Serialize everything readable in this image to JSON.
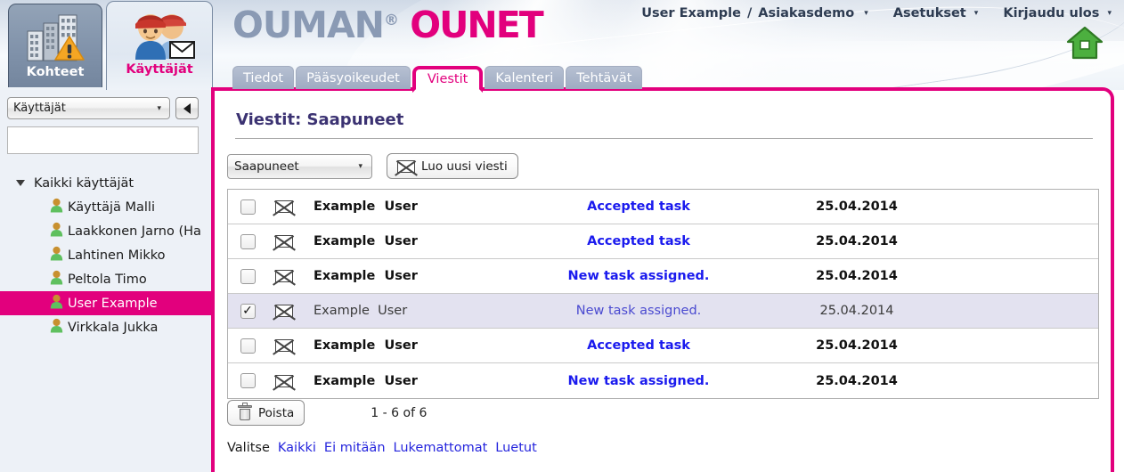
{
  "header": {
    "logo_primary": "OUMAN",
    "logo_reg": "®",
    "logo_secondary": "OUNET",
    "nav": {
      "user": "User Example",
      "separator": "/",
      "customer": "Asiakasdemo",
      "settings": "Asetukset",
      "logout": "Kirjaudu ulos",
      "caret": "▾"
    },
    "home_icon": "home-icon"
  },
  "app_tabs": [
    {
      "label": "Kohteet",
      "icon": "buildings-warning-icon",
      "active": false
    },
    {
      "label": "Käyttäjät",
      "icon": "users-mail-icon",
      "active": true
    }
  ],
  "sidebar": {
    "selector_value": "Käyttäjät",
    "collapse_icon": "chevron-left-icon",
    "search_value": "",
    "search_placeholder": "",
    "tree_root": "Kaikki käyttäjät",
    "items": [
      {
        "label": "Käyttäjä Malli",
        "selected": false
      },
      {
        "label": "Laakkonen Jarno (Ha",
        "selected": false
      },
      {
        "label": "Lahtinen Mikko",
        "selected": false
      },
      {
        "label": "Peltola Timo",
        "selected": false
      },
      {
        "label": "User Example",
        "selected": true
      },
      {
        "label": "Virkkala Jukka",
        "selected": false
      }
    ]
  },
  "content_tabs": [
    {
      "label": "Tiedot",
      "active": false
    },
    {
      "label": "Pääsyoikeudet",
      "active": false
    },
    {
      "label": "Viestit",
      "active": true
    },
    {
      "label": "Kalenteri",
      "active": false
    },
    {
      "label": "Tehtävät",
      "active": false
    }
  ],
  "main": {
    "page_title": "Viestit: Saapuneet",
    "folder_select": "Saapuneet",
    "new_message_label": "Luo uusi viesti",
    "new_message_icon": "envelope-icon",
    "rows": [
      {
        "checked": false,
        "read": false,
        "from_first": "Example",
        "from_last": "User",
        "subject": "Accepted task",
        "date": "25.04.2014"
      },
      {
        "checked": false,
        "read": false,
        "from_first": "Example",
        "from_last": "User",
        "subject": "Accepted task",
        "date": "25.04.2014"
      },
      {
        "checked": false,
        "read": false,
        "from_first": "Example",
        "from_last": "User",
        "subject": "New task assigned.",
        "date": "25.04.2014"
      },
      {
        "checked": true,
        "read": true,
        "from_first": "Example",
        "from_last": "User",
        "subject": "New task assigned.",
        "date": "25.04.2014"
      },
      {
        "checked": false,
        "read": false,
        "from_first": "Example",
        "from_last": "User",
        "subject": "Accepted task",
        "date": "25.04.2014"
      },
      {
        "checked": false,
        "read": false,
        "from_first": "Example",
        "from_last": "User",
        "subject": "New task assigned.",
        "date": "25.04.2014"
      }
    ],
    "delete_label": "Poista",
    "delete_icon": "trash-icon",
    "count_text": "1 - 6 of 6",
    "select_label": "Valitse",
    "select_links": [
      {
        "label": "Kaikki"
      },
      {
        "label": "Ei mitään"
      },
      {
        "label": "Lukemattomat"
      },
      {
        "label": "Luetut"
      }
    ]
  },
  "colors": {
    "accent_magenta": "#e2007d",
    "logo_gray": "#8a9ab4",
    "title_purple": "#3b3272",
    "link_blue": "#1a1aee"
  }
}
